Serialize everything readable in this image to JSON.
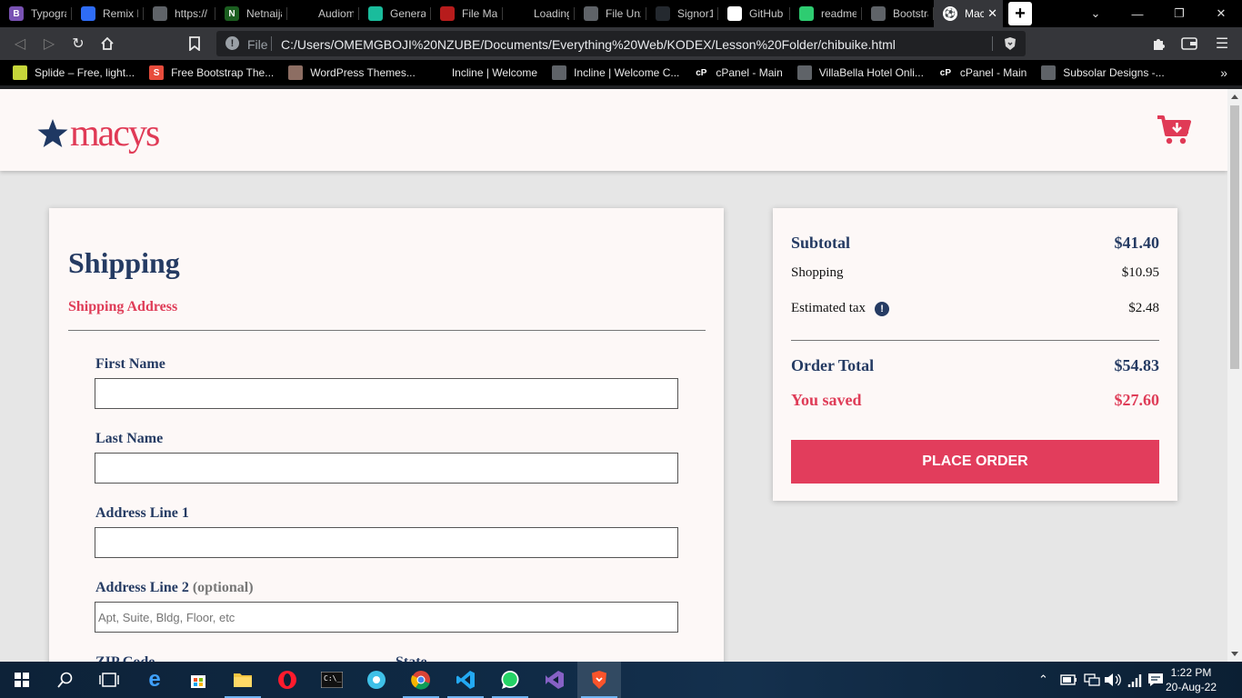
{
  "browser": {
    "tabs": [
      {
        "title": "Typogra",
        "fav_color": "#7952b3",
        "fav_text": "B"
      },
      {
        "title": "Remix Ic",
        "fav_color": "#2e6cf6",
        "fav_text": ""
      },
      {
        "title": "https://",
        "fav_color": "#5f6368",
        "fav_text": ""
      },
      {
        "title": "Netnaija",
        "fav_color": "#1b5e20",
        "fav_text": "N"
      },
      {
        "title": "Audiom",
        "fav_color": "#000000",
        "fav_text": ""
      },
      {
        "title": "General",
        "fav_color": "#1abc9c",
        "fav_text": ""
      },
      {
        "title": "File Man",
        "fav_color": "#b71c1c",
        "fav_text": ""
      },
      {
        "title": "Loading",
        "fav_color": "#000000",
        "fav_text": ""
      },
      {
        "title": "File Unz",
        "fav_color": "#5f6368",
        "fav_text": ""
      },
      {
        "title": "Signor1",
        "fav_color": "#24292f",
        "fav_text": ""
      },
      {
        "title": "GitHub",
        "fav_color": "#ffffff",
        "fav_text": ""
      },
      {
        "title": "readme",
        "fav_color": "#2ecc71",
        "fav_text": ""
      },
      {
        "title": "Bootstra",
        "fav_color": "#5f6368",
        "fav_text": ""
      }
    ],
    "active_tab": {
      "title": "Mac",
      "close": "✕"
    },
    "new_tab": "+",
    "address": {
      "scheme": "File",
      "url": "C:/Users/OMEMGBOJI%20NZUBE/Documents/Everything%20Web/KODEX/Lesson%20Folder/chibuike.html"
    },
    "bookmarks": [
      {
        "label": "Splide – Free, light...",
        "fav_color": "#c6d63a",
        "fav_text": ""
      },
      {
        "label": "Free Bootstrap The...",
        "fav_color": "#e74c3c",
        "fav_text": "S"
      },
      {
        "label": "WordPress Themes...",
        "fav_color": "#8d6e63",
        "fav_text": ""
      },
      {
        "label": "Incline | Welcome",
        "fav_color": "#000000",
        "fav_text": ""
      },
      {
        "label": "Incline | Welcome C...",
        "fav_color": "#5f6368",
        "fav_text": ""
      },
      {
        "label": "cPanel - Main",
        "fav_color": "#000000",
        "fav_text": "cP"
      },
      {
        "label": "VillaBella Hotel Onli...",
        "fav_color": "#5f6368",
        "fav_text": ""
      },
      {
        "label": "cPanel - Main",
        "fav_color": "#000000",
        "fav_text": "cP"
      },
      {
        "label": "Subsolar Designs -...",
        "fav_color": "#5f6368",
        "fav_text": ""
      }
    ],
    "bookmarks_more": "»"
  },
  "site": {
    "brand": "macys",
    "colors": {
      "navy": "#253b63",
      "red": "#df3d58",
      "button": "#e23d5c"
    }
  },
  "shipping": {
    "title": "Shipping",
    "subtitle": "Shipping Address",
    "fields": [
      {
        "label": "First Name",
        "optional": "",
        "value": "",
        "placeholder": ""
      },
      {
        "label": "Last Name",
        "optional": "",
        "value": "",
        "placeholder": ""
      },
      {
        "label": "Address Line 1",
        "optional": "",
        "value": "",
        "placeholder": ""
      },
      {
        "label": "Address Line 2",
        "optional": "(optional)",
        "value": "",
        "placeholder": "Apt, Suite, Bldg, Floor, etc"
      }
    ],
    "partial_labels": [
      "ZIP Code",
      "State"
    ]
  },
  "summary": {
    "subtotal_label": "Subtotal",
    "subtotal": "$41.40",
    "shipping_label": "Shopping",
    "shipping": "$10.95",
    "tax_label": "Estimated tax",
    "tax_icon": "!",
    "tax": "$2.48",
    "total_label": "Order Total",
    "total": "$54.83",
    "saved_label": "You saved",
    "saved": "$27.60",
    "place_order": "PLACE ORDER"
  },
  "taskbar": {
    "time": "1:22 PM",
    "date": "20-Aug-22"
  }
}
